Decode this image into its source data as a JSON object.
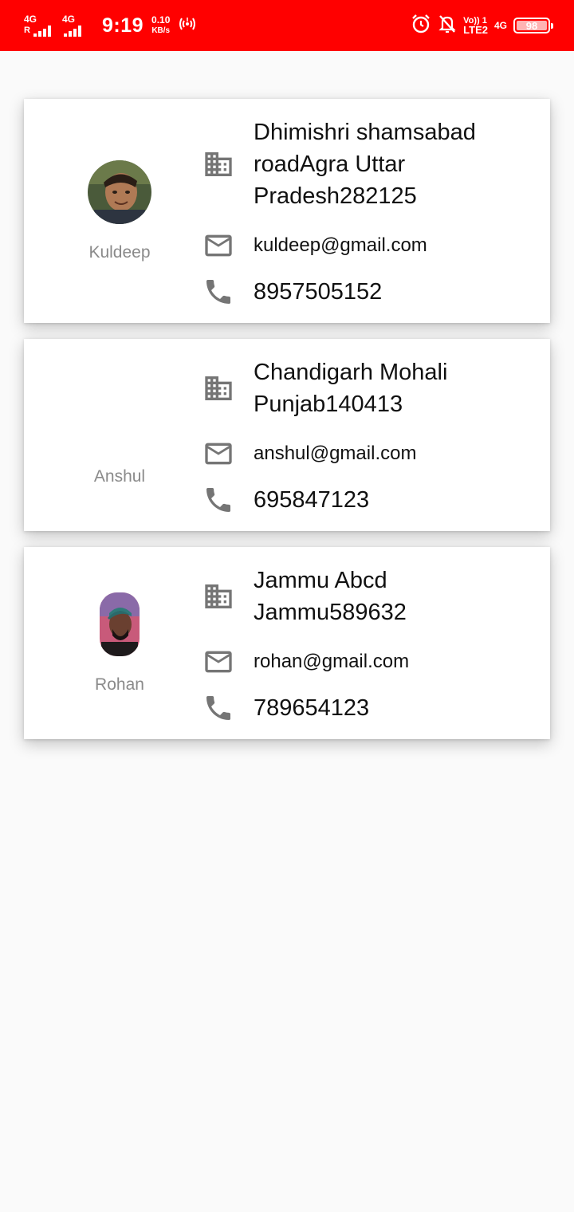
{
  "status_bar": {
    "sim1_network": "4G",
    "sim1_roaming": "R",
    "sim2_network": "4G",
    "time": "9:19",
    "speed_value": "0.10",
    "speed_unit": "KB/s",
    "hotspot_icon": "hotspot-icon",
    "alarm_icon": "alarm-icon",
    "mute_icon": "notifications-off-icon",
    "volte_top": "Vo)) 1",
    "volte_bottom": "LTE2",
    "network_right": "4G",
    "battery_level": "98",
    "color": "#ff0000"
  },
  "contacts": [
    {
      "name": "Kuldeep",
      "avatar": "photo",
      "address": "Dhimishri shamsabad roadAgra  Uttar Pradesh282125",
      "email": "kuldeep@gmail.com",
      "phone": "8957505152"
    },
    {
      "name": "Anshul",
      "avatar": "none",
      "address": "Chandigarh Mohali Punjab140413",
      "email": "anshul@gmail.com",
      "phone": "695847123"
    },
    {
      "name": "Rohan",
      "avatar": "photo",
      "address": "Jammu Abcd Jammu589632",
      "email": "rohan@gmail.com",
      "phone": "789654123"
    }
  ],
  "icons": {
    "address": "business-building-icon",
    "email": "mail-icon",
    "phone": "phone-icon",
    "icon_color": "#757575"
  }
}
